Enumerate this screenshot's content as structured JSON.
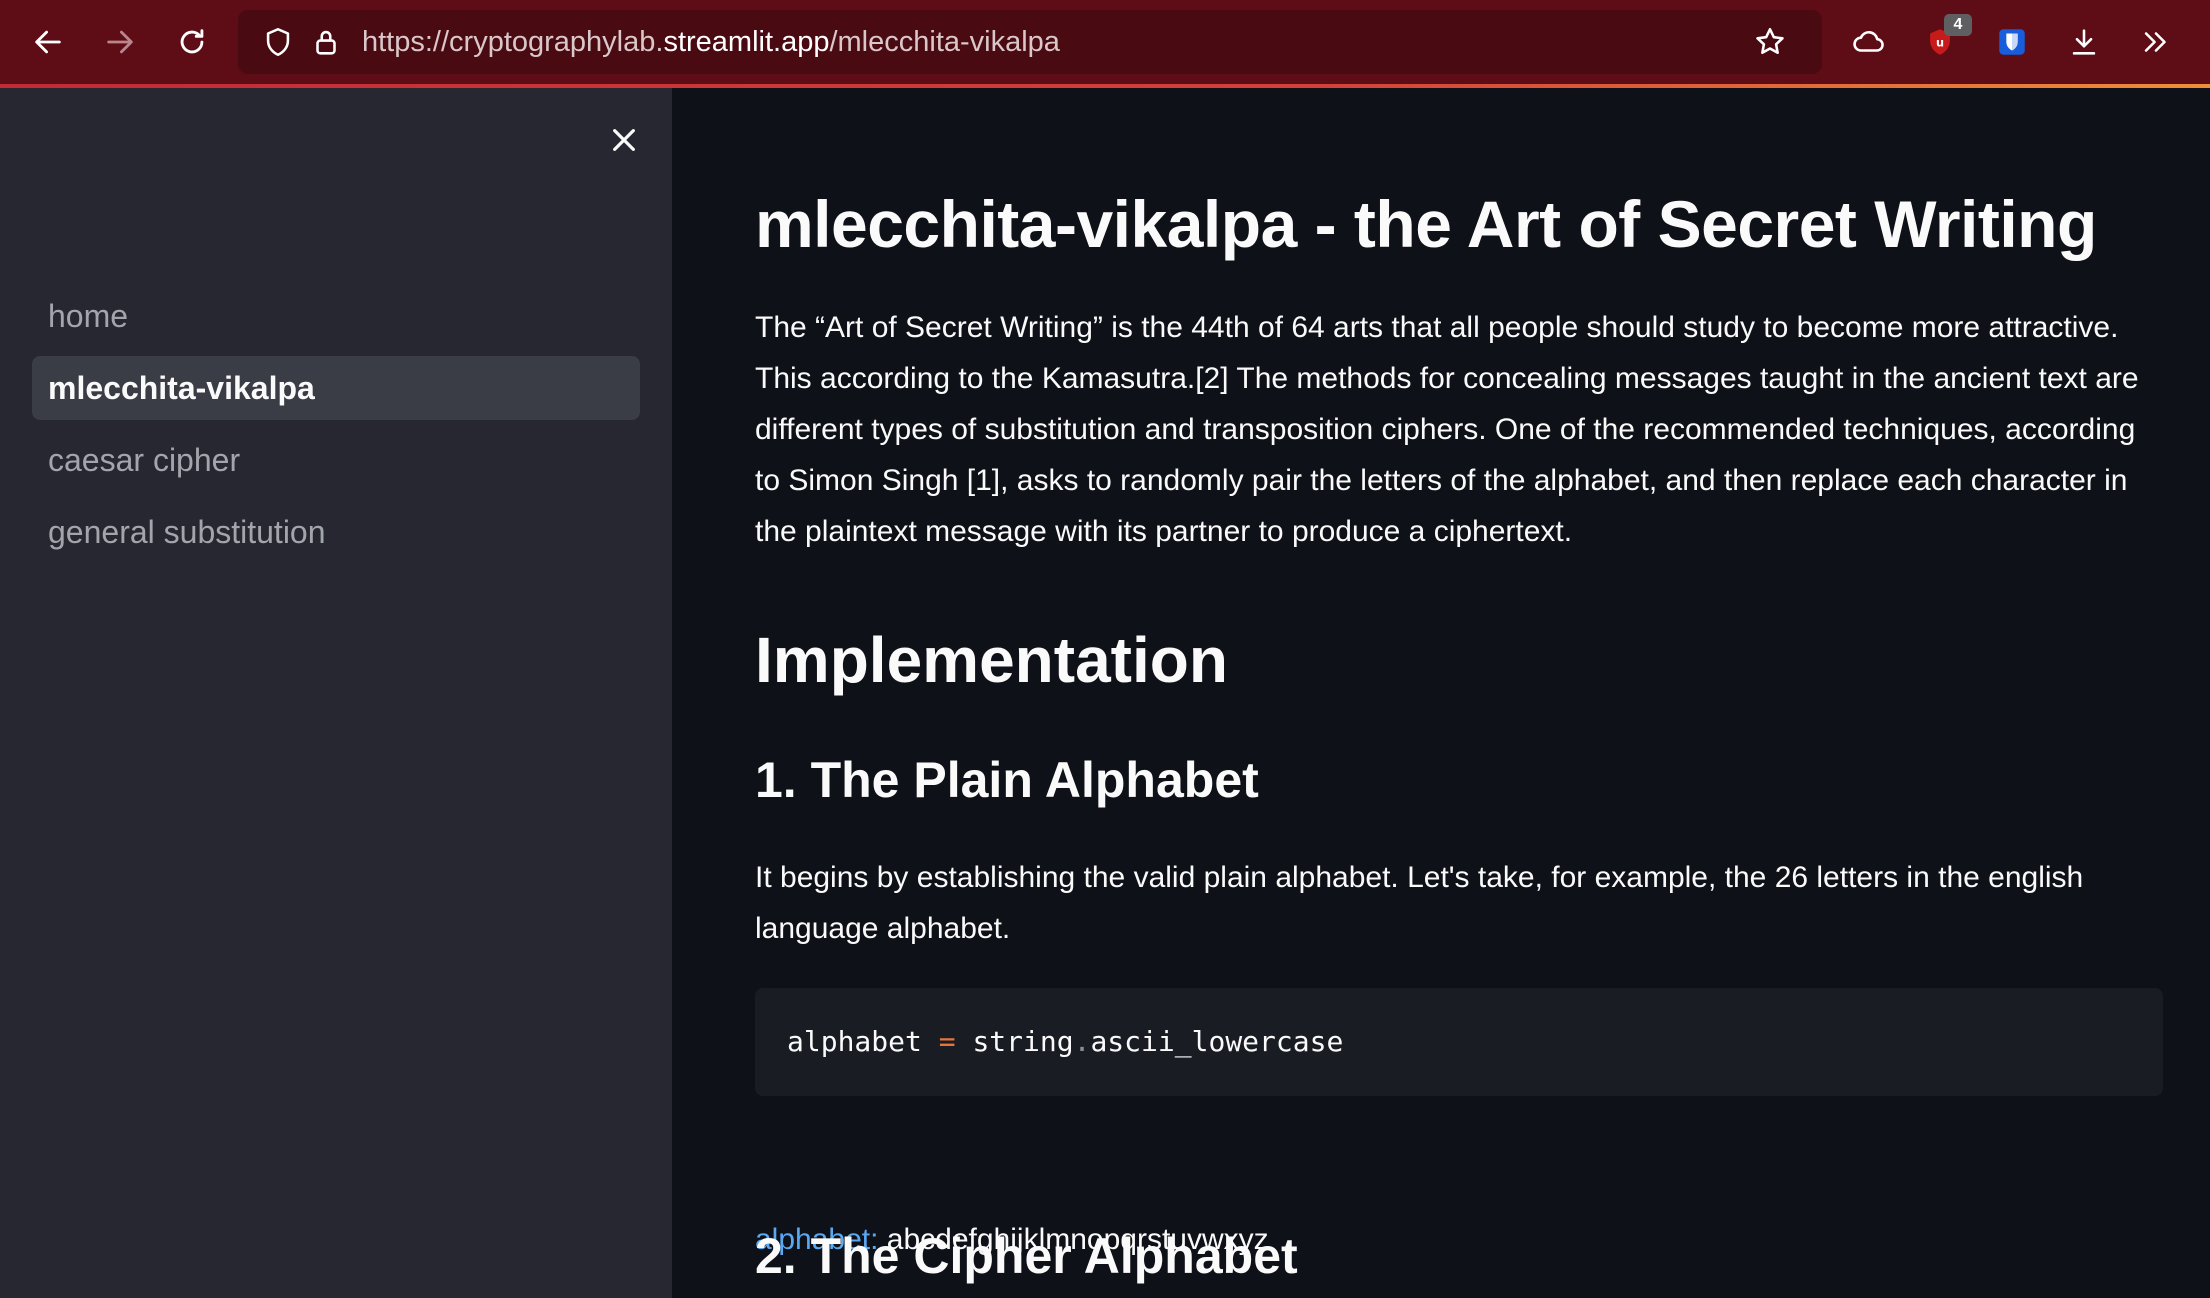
{
  "browser": {
    "url_prefix": "https://cryptographylab.",
    "url_domain": "streamlit.app",
    "url_path": "/mlecchita-vikalpa",
    "extension_badge": "4",
    "accent_color": "#5e0d16"
  },
  "sidebar": {
    "items": [
      {
        "label": "home",
        "active": false
      },
      {
        "label": "mlecchita-vikalpa",
        "active": true
      },
      {
        "label": "caesar cipher",
        "active": false
      },
      {
        "label": "general substitution",
        "active": false
      }
    ]
  },
  "main": {
    "title": "mlecchita-vikalpa - the Art of Secret Writing",
    "intro": "The “Art of Secret Writing” is the 44th of 64 arts that all people should study to become more attractive. This according to the Kamasutra.[2] The methods for concealing messages taught in the ancient text are different types of substitution and transposition ciphers. One of the recommended techniques, according to Simon Singh [1], asks to randomly pair the letters of the alphabet, and then replace each character in the plaintext message with its partner to produce a ciphertext.",
    "implementation_heading": "Implementation",
    "section1_heading": "1. The Plain Alphabet",
    "section1_text": "It begins by establishing the valid plain alphabet. Let's take, for example, the 26 letters in the english language alphabet.",
    "code": {
      "var": "alphabet",
      "op": "=",
      "module": "string",
      "dot": ".",
      "attr": "ascii_lowercase"
    },
    "output_key": "alphabet:",
    "output_value": "abcdefghijklmnopqrstuvwxyz",
    "section2_heading": "2. The Cipher Alphabet"
  }
}
